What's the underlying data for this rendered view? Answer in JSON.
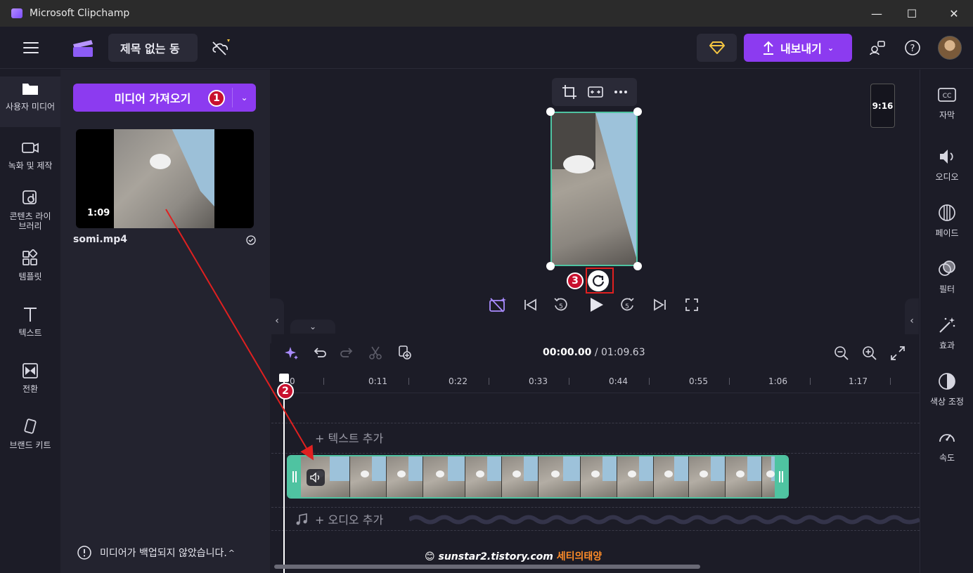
{
  "window": {
    "title": "Microsoft Clipchamp",
    "minimize": "—",
    "maximize": "☐",
    "close": "✕"
  },
  "appbar": {
    "project_title": "제목 없는 동",
    "export_label": "내보내기"
  },
  "leftnav": {
    "items": [
      {
        "label": "사용자 미디어",
        "icon": "folder-icon"
      },
      {
        "label": "녹화 및 제작",
        "icon": "video-camera-icon"
      },
      {
        "label": "콘텐츠 라이브러리",
        "icon": "content-library-icon"
      },
      {
        "label": "템플릿",
        "icon": "templates-icon"
      },
      {
        "label": "텍스트",
        "icon": "text-icon"
      },
      {
        "label": "전환",
        "icon": "transition-icon"
      },
      {
        "label": "브랜드 키트",
        "icon": "brand-kit-icon"
      }
    ]
  },
  "media": {
    "import_label": "미디어 가져오기",
    "file_name": "somi.mp4",
    "duration": "1:09",
    "backup_note": "미디어가 백업되지 않았습니다."
  },
  "preview": {
    "aspect_ratio": "9:16"
  },
  "markers": {
    "m1": "1",
    "m2": "2",
    "m3": "3"
  },
  "rightnav": {
    "items": [
      {
        "label": "자막",
        "icon": "captions-icon"
      },
      {
        "label": "오디오",
        "icon": "audio-icon"
      },
      {
        "label": "페이드",
        "icon": "fade-icon"
      },
      {
        "label": "필터",
        "icon": "filter-icon"
      },
      {
        "label": "효과",
        "icon": "effects-icon"
      },
      {
        "label": "색상 조정",
        "icon": "color-adjust-icon"
      },
      {
        "label": "속도",
        "icon": "speed-icon"
      }
    ]
  },
  "timeline": {
    "current_time": "00:00.00",
    "separator": " / ",
    "total_time": "01:09.63",
    "ticks": [
      "0",
      "0:11",
      "0:22",
      "0:33",
      "0:44",
      "0:55",
      "1:06",
      "1:17"
    ],
    "add_text": "+ 텍스트 추가",
    "add_audio": "+ 오디오 추가"
  },
  "watermark": {
    "site": "sunstar2.tistory.com",
    "name": "세티의태양"
  },
  "colors": {
    "accent": "#8c3bf0",
    "clip_border": "#4fc3a1",
    "annotation_red": "#e02020"
  }
}
